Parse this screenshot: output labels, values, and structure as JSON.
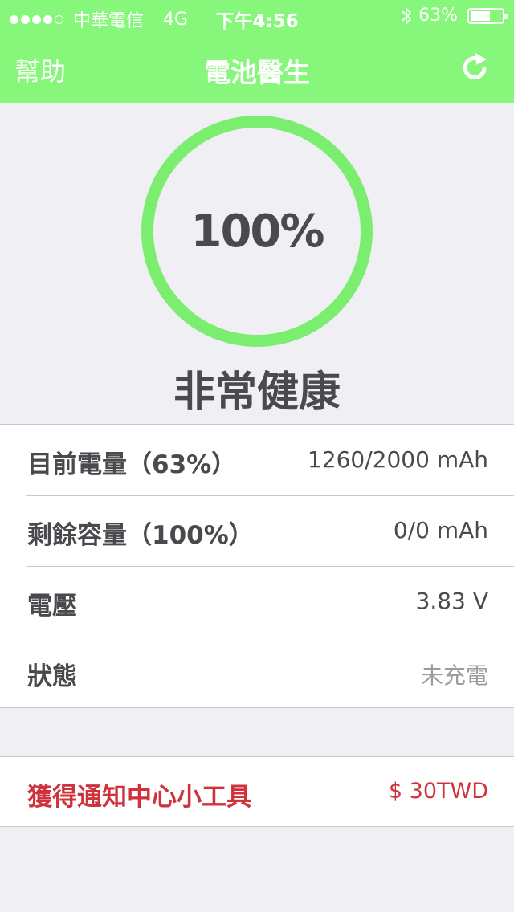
{
  "status_bar": {
    "signal_filled": 4,
    "signal_total": 5,
    "carrier": "中華電信",
    "network": "4G",
    "time": "下午4:56",
    "bluetooth_icon": "bluetooth-icon",
    "battery_percent_label": "63%",
    "battery_level": 0.63
  },
  "nav": {
    "help_label": "幫助",
    "title": "電池醫生",
    "refresh_icon": "refresh-icon"
  },
  "gauge": {
    "percent_label": "100%",
    "level": 1.0,
    "ring_color": "#7cee6f"
  },
  "health_label": "非常健康",
  "info_rows": [
    {
      "label": "目前電量（63%）",
      "value": "1260/2000 mAh"
    },
    {
      "label": "剩餘容量（100%）",
      "value": "0/0 mAh"
    },
    {
      "label": "電壓",
      "value": "3.83 V"
    },
    {
      "label": "狀態",
      "value": "未充電"
    }
  ],
  "purchase": {
    "label": "獲得通知中心小工具",
    "price": "$ 30TWD",
    "color": "#d0323c"
  },
  "colors": {
    "accent": "#86f77a",
    "background": "#efeff4",
    "text": "#4a4a4e"
  }
}
